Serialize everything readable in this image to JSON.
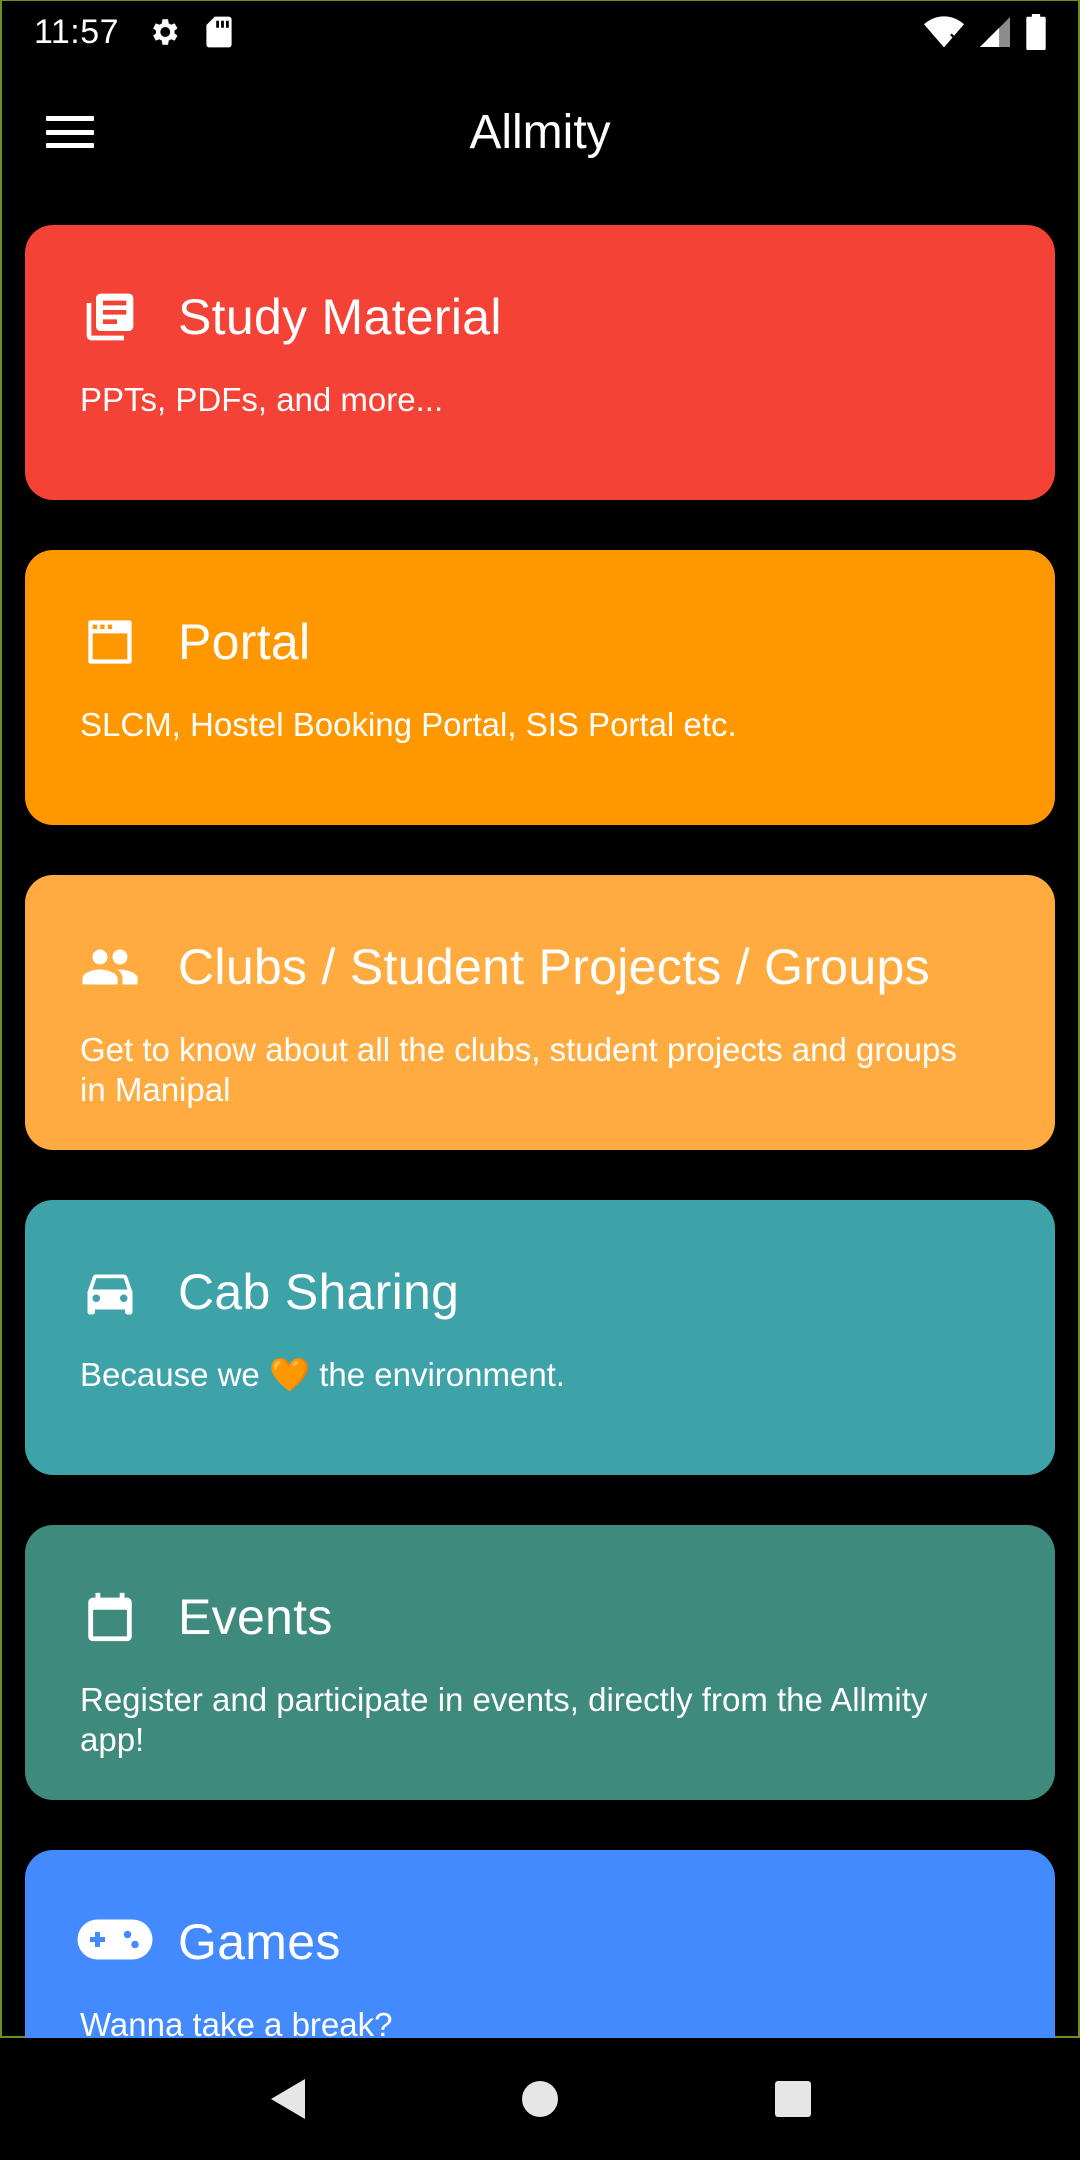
{
  "status_bar": {
    "time": "11:57",
    "left_icons": [
      "gear-icon",
      "sd-card-icon"
    ],
    "right_icons": [
      "wifi-icon",
      "signal-icon",
      "battery-icon"
    ]
  },
  "app_bar": {
    "title": "Allmity",
    "menu_icon": "hamburger-menu-icon"
  },
  "cards": [
    {
      "title": "Study Material",
      "description": "PPTs, PDFs, and more...",
      "icon": "library-books-icon",
      "color": "#f44336"
    },
    {
      "title": "Portal",
      "description": "SLCM, Hostel Booking Portal, SIS Portal etc.",
      "icon": "web-window-icon",
      "color": "#ff9800"
    },
    {
      "title": "Clubs / Student Projects / Groups",
      "description": "Get to know about all the clubs, student projects and groups in Manipal",
      "icon": "people-icon",
      "color": "#ffab40"
    },
    {
      "title": "Cab Sharing",
      "description": "Because we 🧡 the environment.",
      "icon": "car-icon",
      "color": "#3ea2a9"
    },
    {
      "title": "Events",
      "description": "Register and participate in events, directly from the Allmity app!",
      "icon": "calendar-icon",
      "color": "#3e8a7d"
    },
    {
      "title": "Games",
      "description": "Wanna take a break?",
      "icon": "gamepad-icon",
      "color": "#448aff"
    }
  ],
  "nav_bar": {
    "back_icon": "back-triangle-icon",
    "home_icon": "home-circle-icon",
    "recents_icon": "recents-square-icon"
  }
}
